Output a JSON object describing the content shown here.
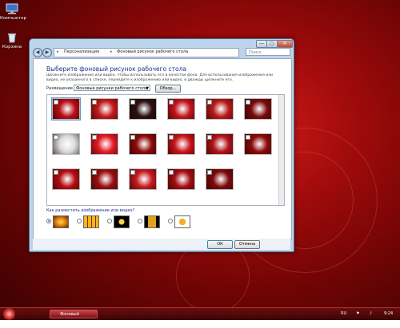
{
  "desktop": {
    "icons": [
      {
        "name": "computer-icon",
        "label": "Компьютер"
      },
      {
        "name": "recycle-bin-icon",
        "label": "Корзина"
      }
    ]
  },
  "window": {
    "controls": {
      "minimize": "—",
      "maximize": "□",
      "close": "✕"
    },
    "nav": {
      "back": "◀",
      "forward": "▶"
    },
    "breadcrumb": [
      "Персонализация",
      "Фоновый рисунок рабочего стола"
    ],
    "breadcrumb_sep": "▸",
    "search_placeholder": "Поиск",
    "heading": "Выберите фоновый рисунок рабочего стола",
    "description": "Щелкните изображение или видео, чтобы использовать его в качестве фона. Для использования изображения или видео, не указанного в списке, перейдите к изображению или видео, и дважды щелкните его.",
    "placement_label": "Размещение",
    "placement_value": "Фоновые рисунки рабочего стола",
    "browse_label": "Обзор...",
    "position_question": "Как разместить изображение или видео?",
    "ok_label": "ОК",
    "cancel_label": "Отмена"
  },
  "gallery_colors": [
    [
      "#b80f16",
      "#c41a1a",
      "#2b1010",
      "#c3161c",
      "#b81a1a",
      "#7a0a0a"
    ],
    [
      "#dadada",
      "#e21b24",
      "#8a0b0b",
      "#c8161c",
      "#b01418",
      "#8c0a0a"
    ],
    [
      "#b60d12",
      "#9a1010",
      "#c61a20",
      "#a40e12",
      "#7d0a0a"
    ]
  ],
  "taskbar": {
    "task_label": "Фоновый рисунок...",
    "language": "RU",
    "clock": "9:24"
  },
  "colors": {
    "accent": "#1e3287",
    "desktop_red": "#a10b0b"
  }
}
